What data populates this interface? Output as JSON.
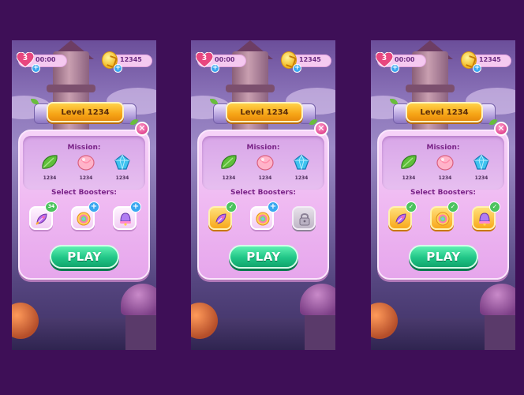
{
  "screens": [
    {
      "hud": {
        "lives": "3",
        "timer": "00:00",
        "coins": "12345"
      },
      "level_label": "Level 1234",
      "mission": {
        "title": "Mission:",
        "targets": [
          {
            "icon": "green-leaf-icon",
            "count": "1234"
          },
          {
            "icon": "pink-shell-icon",
            "count": "1234"
          },
          {
            "icon": "blue-gem-icon",
            "count": "1234"
          }
        ]
      },
      "boosters_title": "Select Boosters:",
      "boosters": [
        {
          "icon": "rocket-candy-icon",
          "badge": "count",
          "badge_text": "34",
          "state": "available"
        },
        {
          "icon": "rainbow-ball-icon",
          "badge": "plus",
          "badge_text": "+",
          "state": "available"
        },
        {
          "icon": "bell-candy-icon",
          "badge": "plus",
          "badge_text": "+",
          "state": "available"
        }
      ],
      "play_label": "PLAY"
    },
    {
      "hud": {
        "lives": "3",
        "timer": "00:00",
        "coins": "12345"
      },
      "level_label": "Level 1234",
      "mission": {
        "title": "Mission:",
        "targets": [
          {
            "icon": "green-leaf-icon",
            "count": "1234"
          },
          {
            "icon": "pink-shell-icon",
            "count": "1234"
          },
          {
            "icon": "blue-gem-icon",
            "count": "1234"
          }
        ]
      },
      "boosters_title": "Select Boosters:",
      "boosters": [
        {
          "icon": "rocket-candy-icon",
          "badge": "check",
          "badge_text": "✓",
          "state": "selected"
        },
        {
          "icon": "rainbow-ball-icon",
          "badge": "plus",
          "badge_text": "+",
          "state": "available"
        },
        {
          "icon": "lock-icon",
          "badge": "none",
          "badge_text": "",
          "state": "locked"
        }
      ],
      "play_label": "PLAY"
    },
    {
      "hud": {
        "lives": "3",
        "timer": "00:00",
        "coins": "12345"
      },
      "level_label": "Level 1234",
      "mission": {
        "title": "Mission:",
        "targets": [
          {
            "icon": "green-leaf-icon",
            "count": "1234"
          },
          {
            "icon": "pink-shell-icon",
            "count": "1234"
          },
          {
            "icon": "blue-gem-icon",
            "count": "1234"
          }
        ]
      },
      "boosters_title": "Select Boosters:",
      "boosters": [
        {
          "icon": "rocket-candy-icon",
          "badge": "check",
          "badge_text": "✓",
          "state": "selected"
        },
        {
          "icon": "rainbow-ball-icon",
          "badge": "check",
          "badge_text": "✓",
          "state": "selected"
        },
        {
          "icon": "bell-candy-icon",
          "badge": "check",
          "badge_text": "✓",
          "state": "selected"
        }
      ],
      "play_label": "PLAY"
    }
  ],
  "colors": {
    "background": "#3e0f57",
    "dialog": "#efb9f2",
    "banner": "#f7a617",
    "play_button": "#21c587",
    "heart": "#e8467f",
    "plus_badge": "#3aa7f0",
    "check_badge": "#4cc35e"
  }
}
